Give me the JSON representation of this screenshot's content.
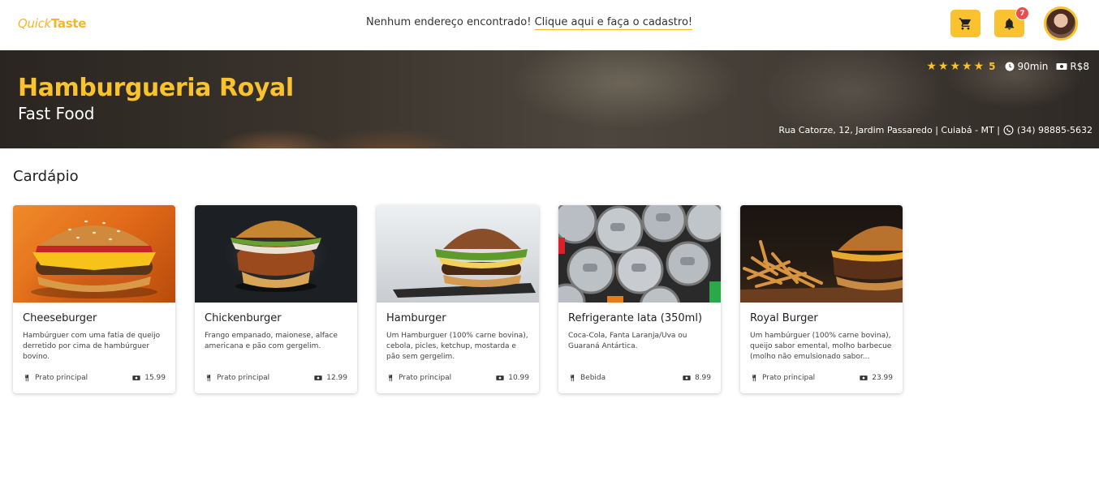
{
  "header": {
    "logo_part1": "Quick",
    "logo_part2": "Taste",
    "address_message": "Nenhum endereço encontrado!",
    "address_link": "Clique aqui e faça o cadastro!",
    "notifications_count": "7",
    "accent_color": "#f9c22e"
  },
  "restaurant": {
    "name": "Hamburgueria Royal",
    "category": "Fast Food",
    "rating": "5",
    "stars": 5,
    "delivery_time": "90min",
    "delivery_fee": "R$8",
    "address": "Rua Catorze, 12, Jardim Passaredo | Cuiabá - MT |",
    "phone": "(34) 98885-5632"
  },
  "menu": {
    "title": "Cardápio",
    "items": [
      {
        "name": "Cheeseburger",
        "description": "Hambúrguer com uma fatia de queijo derretido por cima de hambúrguer bovino.",
        "category": "Prato principal",
        "price": "15.99",
        "image": "cheeseburger-photo"
      },
      {
        "name": "Chickenburger",
        "description": "Frango empanado, maionese, alface americana e pão com gergelim.",
        "category": "Prato principal",
        "price": "12.99",
        "image": "chickenburger-photo"
      },
      {
        "name": "Hamburger",
        "description": "Um Hamburguer (100% carne bovina), cebola, picles, ketchup, mostarda e pão sem gergelim.",
        "category": "Prato principal",
        "price": "10.99",
        "image": "hamburger-photo"
      },
      {
        "name": "Refrigerante lata (350ml)",
        "description": "Coca-Cola, Fanta Laranja/Uva ou Guaraná Antártica.",
        "category": "Bebida",
        "price": "8.99",
        "image": "soda-cans-photo"
      },
      {
        "name": "Royal Burger",
        "description": "Um hambúrguer (100% carne bovina), queijo sabor emental, molho barbecue (molho não emulsionado sabor...",
        "category": "Prato principal",
        "price": "23.99",
        "image": "royal-burger-photo"
      }
    ]
  }
}
